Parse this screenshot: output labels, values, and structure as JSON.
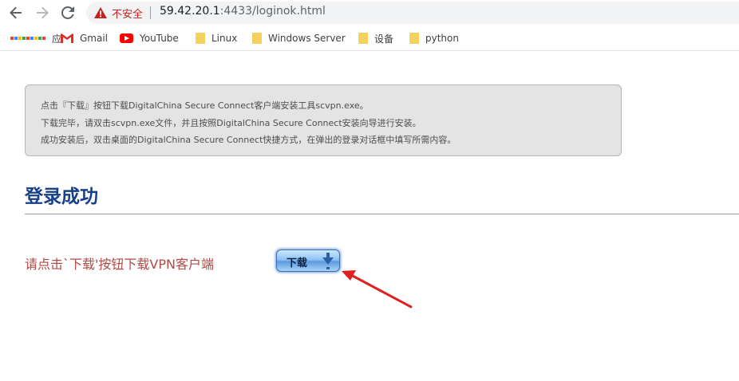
{
  "browser": {
    "security_label": "不安全",
    "url_host": "59.42.20.1",
    "url_path": ":4433/loginok.html"
  },
  "bookmarks": [
    {
      "label": "应用",
      "icon": "apps-icon"
    },
    {
      "label": "Gmail",
      "icon": "gmail-icon"
    },
    {
      "label": "YouTube",
      "icon": "youtube-icon"
    },
    {
      "label": "Linux",
      "icon": "folder-icon"
    },
    {
      "label": "Windows Server",
      "icon": "folder-icon"
    },
    {
      "label": "设备",
      "icon": "folder-icon"
    },
    {
      "label": "python",
      "icon": "folder-icon"
    }
  ],
  "notice": {
    "line1": "点击『下载』按钮下载DigitalChina Secure Connect客户端安装工具scvpn.exe。",
    "line2": "下载完毕，请双击scvpn.exe文件，并且按照DigitalChina Secure Connect安装向导进行安装。",
    "line3": "成功安装后，双击桌面的DigitalChina Secure Connect快捷方式，在弹出的登录对话框中填写所需内容。"
  },
  "page": {
    "title": "登录成功",
    "prompt": "请点击`下载'按钮下载VPN客户端",
    "download_label": "下载"
  },
  "colors": {
    "title": "#173e88",
    "prompt": "#b04a46",
    "insecure": "#c5221f",
    "annotation_arrow": "#e02020"
  }
}
